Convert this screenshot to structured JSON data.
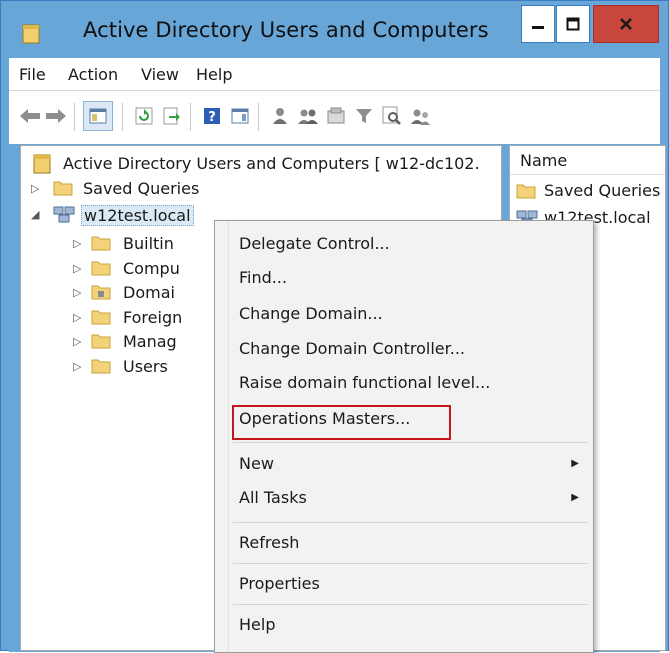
{
  "window": {
    "title": "Active Directory Users and Computers",
    "controls": {
      "minimize": "minimize",
      "maximize": "maximize",
      "close": "close"
    }
  },
  "menubar": {
    "items": [
      "File",
      "Action",
      "View",
      "Help"
    ]
  },
  "toolbar": {
    "icons": [
      "back-arrow-icon",
      "forward-arrow-icon",
      "show-tree-icon",
      "refresh-icon",
      "export-list-icon",
      "help-icon",
      "action-pane-icon",
      "new-user-icon",
      "new-group-icon",
      "new-ou-icon",
      "filter-icon",
      "find-icon",
      "add-to-group-icon"
    ]
  },
  "tree": {
    "root": "Active Directory Users and Computers [ w12-dc102.",
    "saved_queries": "Saved Queries",
    "domain": "w12test.local",
    "children": [
      "Builtin",
      "Compu",
      "Domai",
      "Foreign",
      "Manag",
      "Users"
    ]
  },
  "list_pane": {
    "header": "Name",
    "rows": [
      "Saved Queries",
      "w12test.local"
    ]
  },
  "context_menu": {
    "items": [
      "Delegate Control...",
      "Find...",
      "Change Domain...",
      "Change Domain Controller...",
      "Raise domain functional level...",
      "Operations Masters..."
    ],
    "submenus": [
      "New",
      "All Tasks"
    ],
    "refresh": "Refresh",
    "properties": "Properties",
    "help": "Help",
    "highlighted_item": "Operations Masters..."
  },
  "colors": {
    "titlebar": "#68a6d8",
    "close_button": "#c9463d",
    "highlight_box": "#c4161c",
    "folder": "#f3d27a"
  }
}
